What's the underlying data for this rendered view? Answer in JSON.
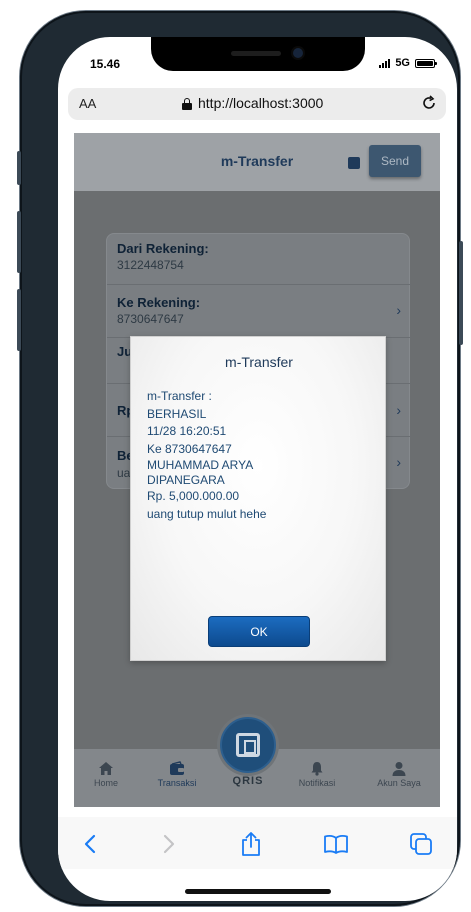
{
  "status_bar": {
    "time": "15.46",
    "network": "5G"
  },
  "browser": {
    "aa_label": "AA",
    "url": "http://localhost:3000"
  },
  "header": {
    "title": "m-Transfer",
    "send_label": "Send"
  },
  "form": {
    "rows": [
      {
        "label": "Dari Rekening:",
        "value": "3122448754"
      },
      {
        "label": "Ke Rekening:",
        "value": "8730647647"
      },
      {
        "label": "Ju",
        "value": ""
      },
      {
        "label": "Rp",
        "value": ""
      },
      {
        "label": "Be",
        "value": "ua"
      }
    ]
  },
  "dialog": {
    "title": "m-Transfer",
    "lines": [
      "m-Transfer :",
      "BERHASIL",
      "11/28 16:20:51",
      "Ke 8730647647",
      "MUHAMMAD ARYA",
      "DIPANEGARA",
      "Rp. 5,000.000.00",
      "uang tutup mulut hehe"
    ],
    "ok_label": "OK"
  },
  "bottom_nav": {
    "items": [
      {
        "label": "Home",
        "icon": "home-icon"
      },
      {
        "label": "Transaksi",
        "icon": "wallet-icon",
        "active": true
      },
      {
        "label": "Notifikasi",
        "icon": "bell-icon"
      },
      {
        "label": "Akun Saya",
        "icon": "user-icon"
      }
    ],
    "qris_label": "QRIS"
  },
  "colors": {
    "accent": "#1f3a5a",
    "ok_button": "#0d4a8e",
    "safari_blue": "#1a7cf5"
  }
}
